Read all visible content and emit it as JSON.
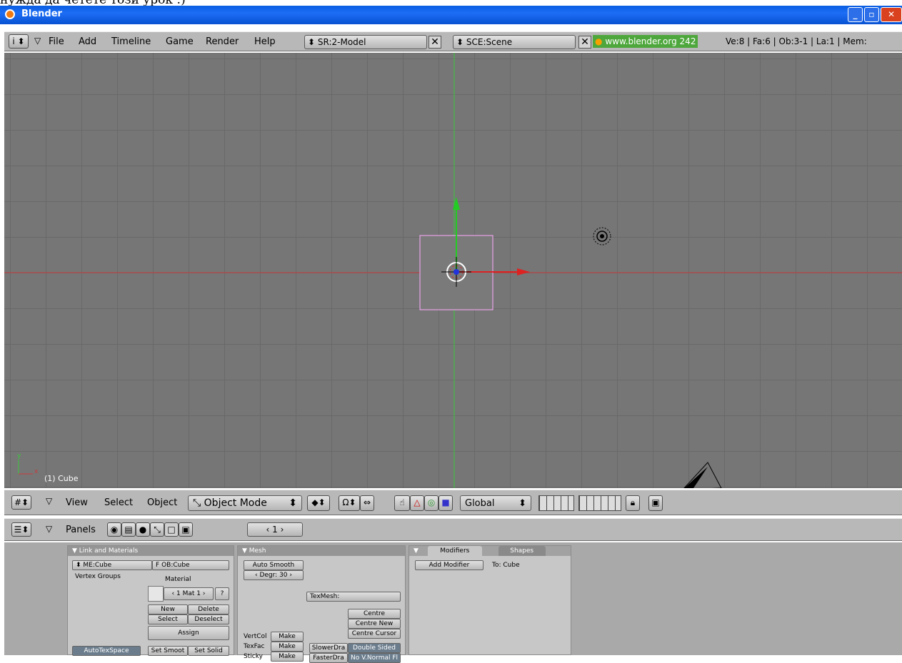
{
  "pre_text": "нужда да четете този урок :)",
  "window": {
    "title": "Blender",
    "min": "_",
    "max": "▫",
    "close": "✕"
  },
  "info_header": {
    "menu": [
      "File",
      "Add",
      "Timeline",
      "Game",
      "Render",
      "Help"
    ],
    "screen": "SR:2-Model",
    "scene": "SCE:Scene",
    "x": "✕",
    "website": "www.blender.org 242",
    "stats": "Ve:8 | Fa:6 | Ob:3-1 | La:1 | Mem:"
  },
  "viewport": {
    "object_label": "(1) Cube",
    "axis_x": "x",
    "axis_y": "y"
  },
  "view3d_header": {
    "menu": [
      "View",
      "Select",
      "Object"
    ],
    "mode": "Object Mode",
    "orientation": "Global"
  },
  "buttons_header": {
    "panels_label": "Panels",
    "frame": "1"
  },
  "panels": {
    "link_materials": {
      "title": "Link and Materials",
      "me": "ME:Cube",
      "f": "F",
      "ob": "OB:Cube",
      "vertex_groups": "Vertex Groups",
      "material": "Material",
      "mat_field": "1 Mat 1",
      "q": "?",
      "new": "New",
      "delete": "Delete",
      "select": "Select",
      "deselect": "Deselect",
      "assign": "Assign",
      "autotex": "AutoTexSpace",
      "set_smooth": "Set Smoot",
      "set_solid": "Set Solid"
    },
    "mesh": {
      "title": "Mesh",
      "auto_smooth": "Auto Smooth",
      "degr": "Degr: 30",
      "texmesh": "TexMesh:",
      "centre": "Centre",
      "centre_new": "Centre New",
      "centre_cursor": "Centre Cursor",
      "vertcol": "VertCol",
      "texfac": "TexFac",
      "sticky": "Sticky",
      "make": "Make",
      "slower": "SlowerDra",
      "faster": "FasterDra",
      "double_sided": "Double Sided",
      "no_v": "No V.Normal Fl"
    },
    "modifiers": {
      "tab1": "Modifiers",
      "tab2": "Shapes",
      "add": "Add Modifier",
      "to": "To: Cube"
    }
  },
  "colors": {
    "x_axis": "#c83c3c",
    "y_axis": "#3cc83c",
    "viewport": "#767676",
    "header": "#b8b8b8",
    "selected": "#ffaaff"
  }
}
